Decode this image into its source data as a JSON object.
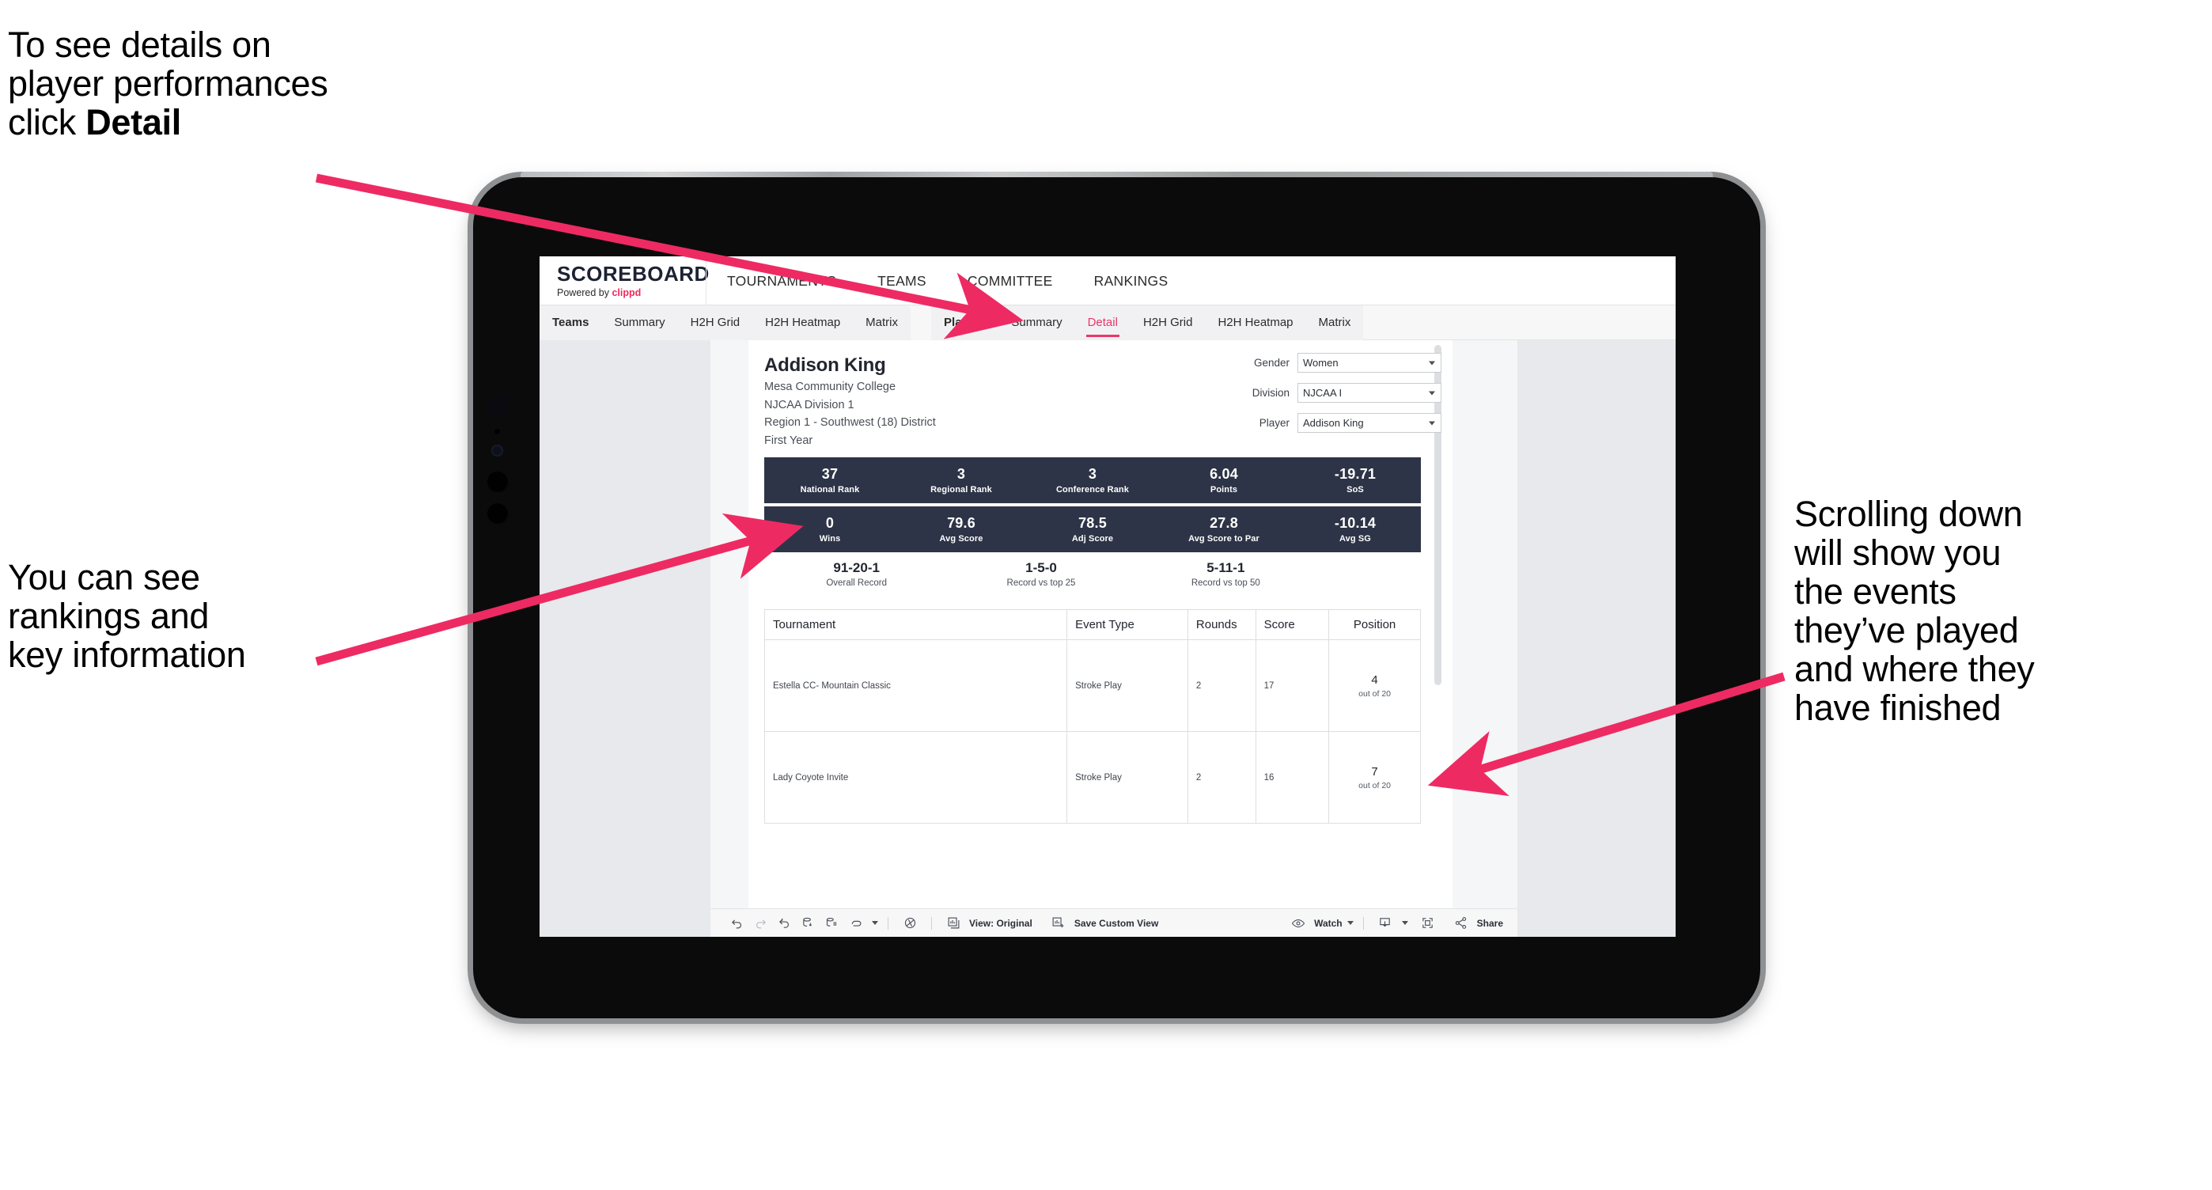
{
  "annotations": {
    "detail_note": "To see details on\nplayer performances\nclick ",
    "detail_note_bold": "Detail",
    "rankings_note": "You can see\nrankings and\nkey information",
    "scroll_note": "Scrolling down\nwill show you\nthe events\nthey’ve played\nand where they\nhave finished"
  },
  "colors": {
    "accent_pink": "#e8386a",
    "arrow_pink": "#ee2a63",
    "stat_navy": "#2e3447",
    "app_bg": "#e7e9ec"
  },
  "app": {
    "brand": {
      "name": "SCOREBOARD",
      "powered_prefix": "Powered by ",
      "powered_by": "clippd"
    },
    "top_nav": [
      "TOURNAMENTS",
      "TEAMS",
      "COMMITTEE",
      "RANKINGS"
    ],
    "sub_nav_teams": [
      "Teams",
      "Summary",
      "H2H Grid",
      "H2H Heatmap",
      "Matrix"
    ],
    "sub_nav_players": [
      "Players",
      "Summary",
      "Detail",
      "H2H Grid",
      "H2H Heatmap",
      "Matrix"
    ],
    "active_sub_tab": "Detail"
  },
  "player": {
    "name": "Addison King",
    "school": "Mesa Community College",
    "division": "NJCAA Division 1",
    "region": "Region 1 - Southwest (18) District",
    "year": "First Year"
  },
  "filters": [
    {
      "label": "Gender",
      "value": "Women"
    },
    {
      "label": "Division",
      "value": "NJCAA I"
    },
    {
      "label": "Player",
      "value": "Addison King"
    }
  ],
  "stats_row1": [
    {
      "value": "37",
      "label": "National Rank"
    },
    {
      "value": "3",
      "label": "Regional Rank"
    },
    {
      "value": "3",
      "label": "Conference Rank"
    },
    {
      "value": "6.04",
      "label": "Points"
    },
    {
      "value": "-19.71",
      "label": "SoS"
    }
  ],
  "stats_row2": [
    {
      "value": "0",
      "label": "Wins"
    },
    {
      "value": "79.6",
      "label": "Avg Score"
    },
    {
      "value": "78.5",
      "label": "Adj Score"
    },
    {
      "value": "27.8",
      "label": "Avg Score to Par"
    },
    {
      "value": "-10.14",
      "label": "Avg SG"
    }
  ],
  "records": [
    {
      "value": "91-20-1",
      "label": "Overall Record"
    },
    {
      "value": "1-5-0",
      "label": "Record vs top 25"
    },
    {
      "value": "5-11-1",
      "label": "Record vs top 50"
    }
  ],
  "events_table": {
    "columns": [
      "Tournament",
      "Event Type",
      "Rounds",
      "Score",
      "Position"
    ],
    "rows": [
      {
        "tournament": "Estella CC- Mountain Classic",
        "event_type": "Stroke Play",
        "rounds": "2",
        "score": "17",
        "position": "4",
        "position_sub": "out of 20"
      },
      {
        "tournament": "Lady Coyote Invite",
        "event_type": "Stroke Play",
        "rounds": "2",
        "score": "16",
        "position": "7",
        "position_sub": "out of 20"
      }
    ]
  },
  "toolbar": {
    "view_label": "View: Original",
    "save_label": "Save Custom View",
    "watch_label": "Watch",
    "share_label": "Share"
  }
}
